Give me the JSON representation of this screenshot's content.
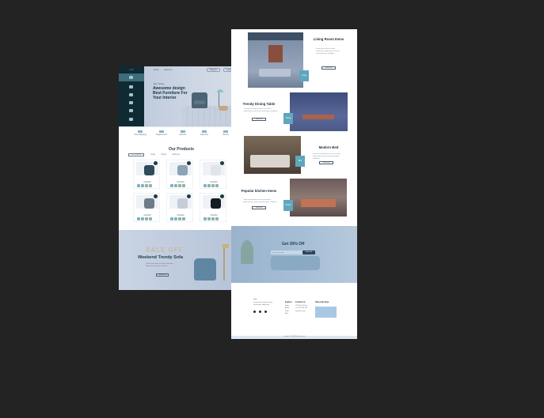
{
  "left_page": {
    "logo": "∞ ∞",
    "nav": [
      "Home",
      "About Us"
    ],
    "nav_right": [
      "Register",
      "Login"
    ],
    "hero": {
      "eyebrow": "Best Selling",
      "title": "Awesome design Best Furniture For Your Interior"
    },
    "features": [
      "Free Shipping",
      "Support 24/7",
      "Returns",
      "Payment",
      "Secure"
    ],
    "products": {
      "title": "Our Products",
      "tabs": [
        "All Products",
        "Living",
        "Dining",
        "Bedroom"
      ],
      "items": [
        {
          "name": "Armchair",
          "stars": "★★★★★",
          "color": "#2f4b5c"
        },
        {
          "name": "Armchair",
          "stars": "★★★★★",
          "color": "#8aa3b5"
        },
        {
          "name": "Armchair",
          "stars": "★★★★★",
          "color": "#e1e4e8"
        },
        {
          "name": "Armchair",
          "stars": "★★★★★",
          "color": "#6d7b88"
        },
        {
          "name": "Armchair",
          "stars": "★★★★★",
          "color": "#c7cdd6"
        },
        {
          "name": "Armchair",
          "stars": "★★★★★",
          "color": "#151b22"
        }
      ]
    },
    "sale": {
      "big": "SALE OFF",
      "title": "Weekend Trendy Sofa",
      "desc": "Lorem ipsum dolor sit amet consectetur adipiscing elit sed do eiusmod",
      "button": "Shop Now"
    }
  },
  "right_page": {
    "rows": [
      {
        "title": "Living Room Items",
        "tag": "Living",
        "button": "Shop Now"
      },
      {
        "title": "Trendy Dining Table",
        "tag": "Dining",
        "button": "Shop Now"
      },
      {
        "title": "Modern Bed",
        "tag": "Bed",
        "button": "Shop Now"
      },
      {
        "title": "Popular kitchen Items",
        "tag": "Kitchen",
        "button": "Shop Now"
      }
    ],
    "row_text": "Lorem ipsum dolor sit amet consectetur adipiscing elit sed do eiusmod tempor incididunt",
    "promo": {
      "title": "Get 30% Off",
      "placeholder": "Enter your email",
      "button": "Subscribe"
    },
    "footer": {
      "about": "Lorem ipsum dolor sit amet consectetur adipiscing",
      "col1_title": "Explore",
      "col1": [
        "Home",
        "About",
        "Shop",
        "Blog",
        "Contact"
      ],
      "col2_title": "Contact Us",
      "col2": [
        "123 Street Name",
        "+00 123 456 789",
        "info@site.com"
      ],
      "col3_title": "Subscribe Now",
      "copyright": "Copyright © 2023 All Rights Reserved"
    }
  },
  "colors": {
    "dark": "#0f2a33",
    "accent": "#5fa7be",
    "canvas": "#232323"
  }
}
